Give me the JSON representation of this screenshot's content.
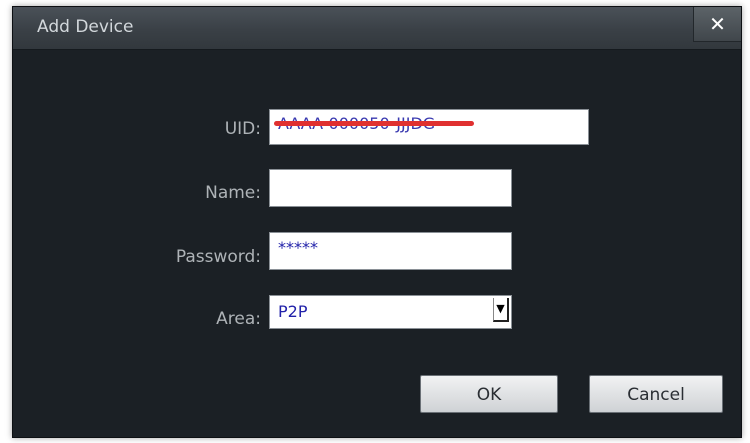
{
  "dialog": {
    "title": "Add Device",
    "close_glyph": "✕"
  },
  "form": {
    "uid": {
      "label": "UID:",
      "value": "AAAA-000050-JJJDG"
    },
    "name": {
      "label": "Name:",
      "value": ""
    },
    "password": {
      "label": "Password:",
      "value": "*****"
    },
    "area": {
      "label": "Area:",
      "value": "P2P",
      "arrow": "▼"
    }
  },
  "buttons": {
    "ok_label": "OK",
    "cancel_label": "Cancel"
  },
  "colors": {
    "dialog_bg": "#1b2025",
    "titlebar": "#3a4046",
    "label_text": "#aeb3b7",
    "field_text": "#2222aa",
    "redaction": "#e03030"
  }
}
